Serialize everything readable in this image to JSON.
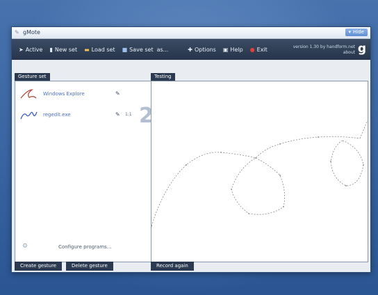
{
  "window": {
    "title": "gMote",
    "hide_label": "Hide"
  },
  "toolbar": {
    "items": [
      {
        "icon": "cursor-icon",
        "label": "Active"
      },
      {
        "icon": "new-document-icon",
        "label": "New set"
      },
      {
        "icon": "folder-icon",
        "label": "Load set"
      },
      {
        "icon": "save-icon",
        "label": "Save set"
      },
      {
        "icon": "",
        "label": "as..."
      },
      {
        "icon": "options-icon",
        "label": "Options"
      },
      {
        "icon": "help-icon",
        "label": "Help"
      },
      {
        "icon": "exit-icon",
        "label": "Exit"
      }
    ],
    "version_line1": "version 1.30 by handform.net",
    "version_line2": "about",
    "brand_letter": "g"
  },
  "gesture_panel": {
    "header": "Gesture set",
    "gestures": [
      {
        "name": "Windows Explore",
        "count": "",
        "stroke_color": "#b24a3a"
      },
      {
        "name": "regedit.exe",
        "count": "1:1",
        "stroke_color": "#3b5fbf"
      }
    ],
    "big_number": "2",
    "configure_label": "Configure programs...",
    "create_button": "Create gesture",
    "delete_button": "Delete gesture"
  },
  "testing_panel": {
    "header": "Testing",
    "record_button": "Record again"
  }
}
